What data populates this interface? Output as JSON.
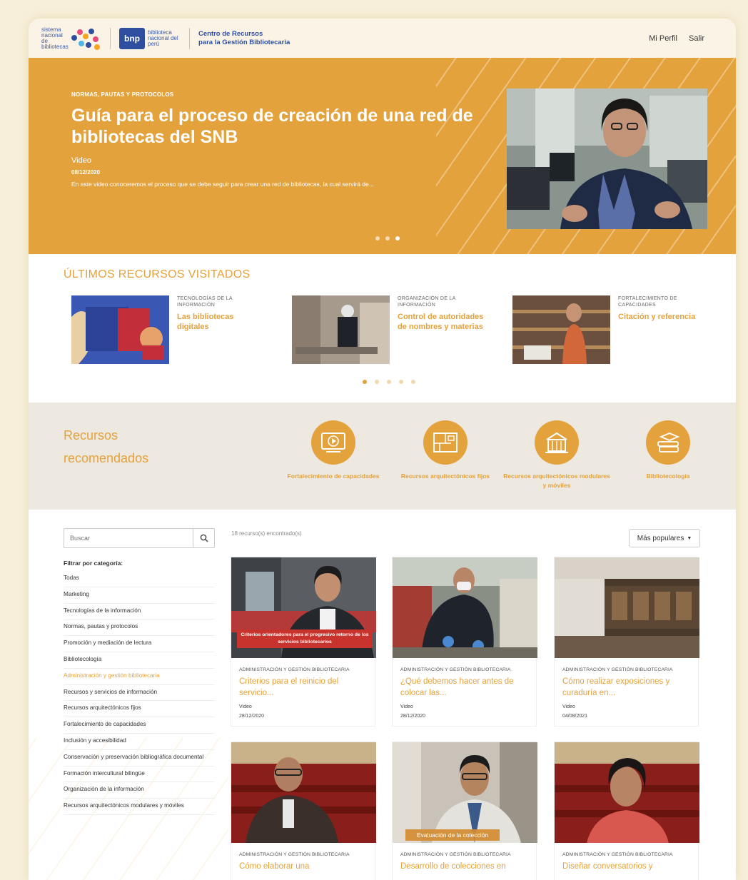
{
  "header": {
    "snb_text": "sistema nacional de bibliotecas",
    "bnp_badge": "bnp",
    "bnp_text": "biblioteca nacional del perú",
    "center_line1": "Centro de Recursos",
    "center_line2": "para la Gestión Bibliotecaria",
    "profile_link": "Mi Perfil",
    "logout_link": "Salir"
  },
  "hero": {
    "category": "NORMAS, PAUTAS Y PROTOCOLOS",
    "title": "Guía para el proceso de creación de una red de bibliotecas del SNB",
    "type": "Video",
    "date": "08/12/2020",
    "description": "En este video conoceremos el proceso que se debe seguir para crear una red de bibliotecas, la cual servirá de...",
    "slide_count": 3,
    "active_slide": 3
  },
  "recent": {
    "title": "ÚLTIMOS RECURSOS VISITADOS",
    "items": [
      {
        "category": "TECNOLOGÍAS DE LA INFORMACIÓN",
        "title": "Las bibliotecas digitales"
      },
      {
        "category": "ORGANIZACIÓN DE LA INFORMACIÓN",
        "title": "Control de autoridades de nombres y materias"
      },
      {
        "category": "FORTALECIMIENTO DE CAPACIDADES",
        "title": "Citación y referencia"
      }
    ],
    "page_count": 5,
    "active_page": 1
  },
  "recommended": {
    "title": "Recursos recomendados",
    "categories": [
      {
        "label": "Fortalecimiento de capacidades",
        "icon": "video-play-icon"
      },
      {
        "label": "Recursos arquitectónicos fijos",
        "icon": "floor-plan-icon"
      },
      {
        "label": "Recursos arquitectónicos modulares y móviles",
        "icon": "building-icon"
      },
      {
        "label": "Bibliotecología",
        "icon": "books-icon"
      }
    ]
  },
  "listing": {
    "search_placeholder": "Buscar",
    "filter_title": "Filtrar por categoría:",
    "filters": [
      "Todas",
      "Marketing",
      "Tecnologías de la información",
      "Normas, pautas y protocolos",
      "Promoción y mediación de lectura",
      "Bibliotecología",
      "Administración y gestión bibliotecaria",
      "Recursos y servicios de información",
      "Recursos arquitectónicos fijos",
      "Fortalecimiento de capacidades",
      "Inclusión y accesibilidad",
      "Conservación y preservación bibliográfica documental",
      "Formación intercultural bilingüe",
      "Organización de la información",
      "Recursos arquitectónicos modulares y móviles"
    ],
    "active_filter": "Administración y gestión bibliotecaria",
    "results_text": "18 recurso(s) encontrado(s)",
    "sort_label": "Más populares",
    "cards": [
      {
        "category": "ADMINISTRACIÓN Y GESTIÓN BIBLIOTECARIA",
        "title": "Criterios para el reinicio del servicio...",
        "type": "Video",
        "date": "28/12/2020",
        "caption": "Criterios orientadores para el progresivo retorno de los servicios bibliotecarios"
      },
      {
        "category": "ADMINISTRACIÓN Y GESTIÓN BIBLIOTECARIA",
        "title": "¿Qué debemos hacer antes de colocar las...",
        "type": "Video",
        "date": "28/12/2020"
      },
      {
        "category": "ADMINISTRACIÓN Y GESTIÓN BIBLIOTECARIA",
        "title": "Cómo realizar exposiciones y curaduría en...",
        "type": "Video",
        "date": "04/08/2021"
      },
      {
        "category": "ADMINISTRACIÓN Y GESTIÓN BIBLIOTECARIA",
        "title": "Cómo elaborar una"
      },
      {
        "category": "ADMINISTRACIÓN Y GESTIÓN BIBLIOTECARIA",
        "title": "Desarrollo de colecciones en",
        "caption": "Evaluación de la colección"
      },
      {
        "category": "ADMINISTRACIÓN Y GESTIÓN BIBLIOTECARIA",
        "title": "Diseñar conversatorios y"
      }
    ]
  },
  "colors": {
    "accent": "#e4a23c",
    "brand_blue": "#2e4fa0",
    "caption_red": "#c8332d"
  }
}
